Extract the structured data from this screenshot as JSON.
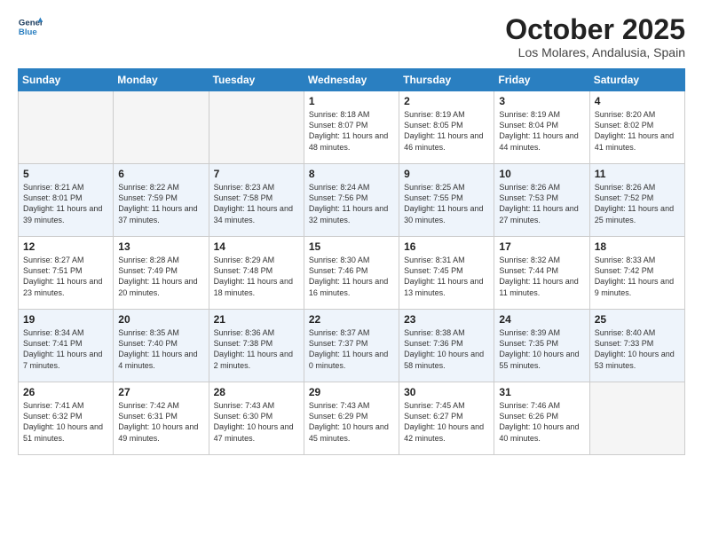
{
  "header": {
    "logo_line1": "General",
    "logo_line2": "Blue",
    "month": "October 2025",
    "location": "Los Molares, Andalusia, Spain"
  },
  "days_of_week": [
    "Sunday",
    "Monday",
    "Tuesday",
    "Wednesday",
    "Thursday",
    "Friday",
    "Saturday"
  ],
  "weeks": [
    [
      {
        "day": "",
        "empty": true
      },
      {
        "day": "",
        "empty": true
      },
      {
        "day": "",
        "empty": true
      },
      {
        "day": "1",
        "sunrise": "8:18 AM",
        "sunset": "8:07 PM",
        "daylight": "11 hours and 48 minutes."
      },
      {
        "day": "2",
        "sunrise": "8:19 AM",
        "sunset": "8:05 PM",
        "daylight": "11 hours and 46 minutes."
      },
      {
        "day": "3",
        "sunrise": "8:19 AM",
        "sunset": "8:04 PM",
        "daylight": "11 hours and 44 minutes."
      },
      {
        "day": "4",
        "sunrise": "8:20 AM",
        "sunset": "8:02 PM",
        "daylight": "11 hours and 41 minutes."
      }
    ],
    [
      {
        "day": "5",
        "sunrise": "8:21 AM",
        "sunset": "8:01 PM",
        "daylight": "11 hours and 39 minutes."
      },
      {
        "day": "6",
        "sunrise": "8:22 AM",
        "sunset": "7:59 PM",
        "daylight": "11 hours and 37 minutes."
      },
      {
        "day": "7",
        "sunrise": "8:23 AM",
        "sunset": "7:58 PM",
        "daylight": "11 hours and 34 minutes."
      },
      {
        "day": "8",
        "sunrise": "8:24 AM",
        "sunset": "7:56 PM",
        "daylight": "11 hours and 32 minutes."
      },
      {
        "day": "9",
        "sunrise": "8:25 AM",
        "sunset": "7:55 PM",
        "daylight": "11 hours and 30 minutes."
      },
      {
        "day": "10",
        "sunrise": "8:26 AM",
        "sunset": "7:53 PM",
        "daylight": "11 hours and 27 minutes."
      },
      {
        "day": "11",
        "sunrise": "8:26 AM",
        "sunset": "7:52 PM",
        "daylight": "11 hours and 25 minutes."
      }
    ],
    [
      {
        "day": "12",
        "sunrise": "8:27 AM",
        "sunset": "7:51 PM",
        "daylight": "11 hours and 23 minutes."
      },
      {
        "day": "13",
        "sunrise": "8:28 AM",
        "sunset": "7:49 PM",
        "daylight": "11 hours and 20 minutes."
      },
      {
        "day": "14",
        "sunrise": "8:29 AM",
        "sunset": "7:48 PM",
        "daylight": "11 hours and 18 minutes."
      },
      {
        "day": "15",
        "sunrise": "8:30 AM",
        "sunset": "7:46 PM",
        "daylight": "11 hours and 16 minutes."
      },
      {
        "day": "16",
        "sunrise": "8:31 AM",
        "sunset": "7:45 PM",
        "daylight": "11 hours and 13 minutes."
      },
      {
        "day": "17",
        "sunrise": "8:32 AM",
        "sunset": "7:44 PM",
        "daylight": "11 hours and 11 minutes."
      },
      {
        "day": "18",
        "sunrise": "8:33 AM",
        "sunset": "7:42 PM",
        "daylight": "11 hours and 9 minutes."
      }
    ],
    [
      {
        "day": "19",
        "sunrise": "8:34 AM",
        "sunset": "7:41 PM",
        "daylight": "11 hours and 7 minutes."
      },
      {
        "day": "20",
        "sunrise": "8:35 AM",
        "sunset": "7:40 PM",
        "daylight": "11 hours and 4 minutes."
      },
      {
        "day": "21",
        "sunrise": "8:36 AM",
        "sunset": "7:38 PM",
        "daylight": "11 hours and 2 minutes."
      },
      {
        "day": "22",
        "sunrise": "8:37 AM",
        "sunset": "7:37 PM",
        "daylight": "11 hours and 0 minutes."
      },
      {
        "day": "23",
        "sunrise": "8:38 AM",
        "sunset": "7:36 PM",
        "daylight": "10 hours and 58 minutes."
      },
      {
        "day": "24",
        "sunrise": "8:39 AM",
        "sunset": "7:35 PM",
        "daylight": "10 hours and 55 minutes."
      },
      {
        "day": "25",
        "sunrise": "8:40 AM",
        "sunset": "7:33 PM",
        "daylight": "10 hours and 53 minutes."
      }
    ],
    [
      {
        "day": "26",
        "sunrise": "7:41 AM",
        "sunset": "6:32 PM",
        "daylight": "10 hours and 51 minutes."
      },
      {
        "day": "27",
        "sunrise": "7:42 AM",
        "sunset": "6:31 PM",
        "daylight": "10 hours and 49 minutes."
      },
      {
        "day": "28",
        "sunrise": "7:43 AM",
        "sunset": "6:30 PM",
        "daylight": "10 hours and 47 minutes."
      },
      {
        "day": "29",
        "sunrise": "7:43 AM",
        "sunset": "6:29 PM",
        "daylight": "10 hours and 45 minutes."
      },
      {
        "day": "30",
        "sunrise": "7:45 AM",
        "sunset": "6:27 PM",
        "daylight": "10 hours and 42 minutes."
      },
      {
        "day": "31",
        "sunrise": "7:46 AM",
        "sunset": "6:26 PM",
        "daylight": "10 hours and 40 minutes."
      },
      {
        "day": "",
        "empty": true
      }
    ]
  ]
}
